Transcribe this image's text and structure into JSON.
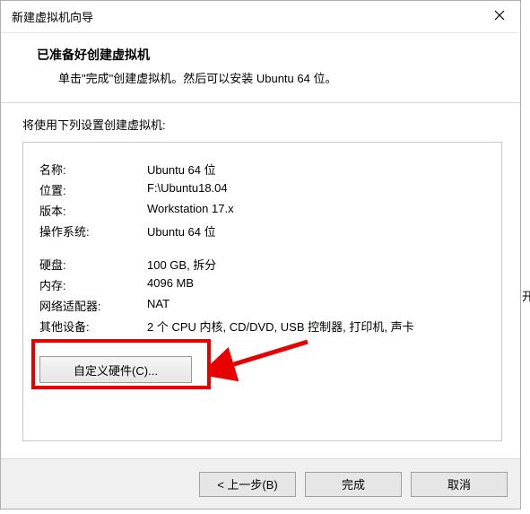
{
  "titlebar": {
    "title": "新建虚拟机向导"
  },
  "header": {
    "title": "已准备好创建虚拟机",
    "subtitle": "单击\"完成\"创建虚拟机。然后可以安装 Ubuntu 64 位。"
  },
  "intro": "将使用下列设置创建虚拟机:",
  "settings": {
    "name_label": "名称:",
    "name_value": "Ubuntu 64 位",
    "location_label": "位置:",
    "location_value": "F:\\Ubuntu18.04",
    "version_label": "版本:",
    "version_value": "Workstation 17.x",
    "os_label": "操作系统:",
    "os_value": "Ubuntu 64 位",
    "disk_label": "硬盘:",
    "disk_value": "100 GB, 拆分",
    "memory_label": "内存:",
    "memory_value": "4096 MB",
    "network_label": "网络适配器:",
    "network_value": "NAT",
    "other_label": "其他设备:",
    "other_value": "2 个 CPU 内核, CD/DVD, USB 控制器, 打印机, 声卡"
  },
  "buttons": {
    "customize": "自定义硬件(C)...",
    "back": "< 上一步(B)",
    "finish": "完成",
    "cancel": "取消"
  },
  "extra": "开"
}
